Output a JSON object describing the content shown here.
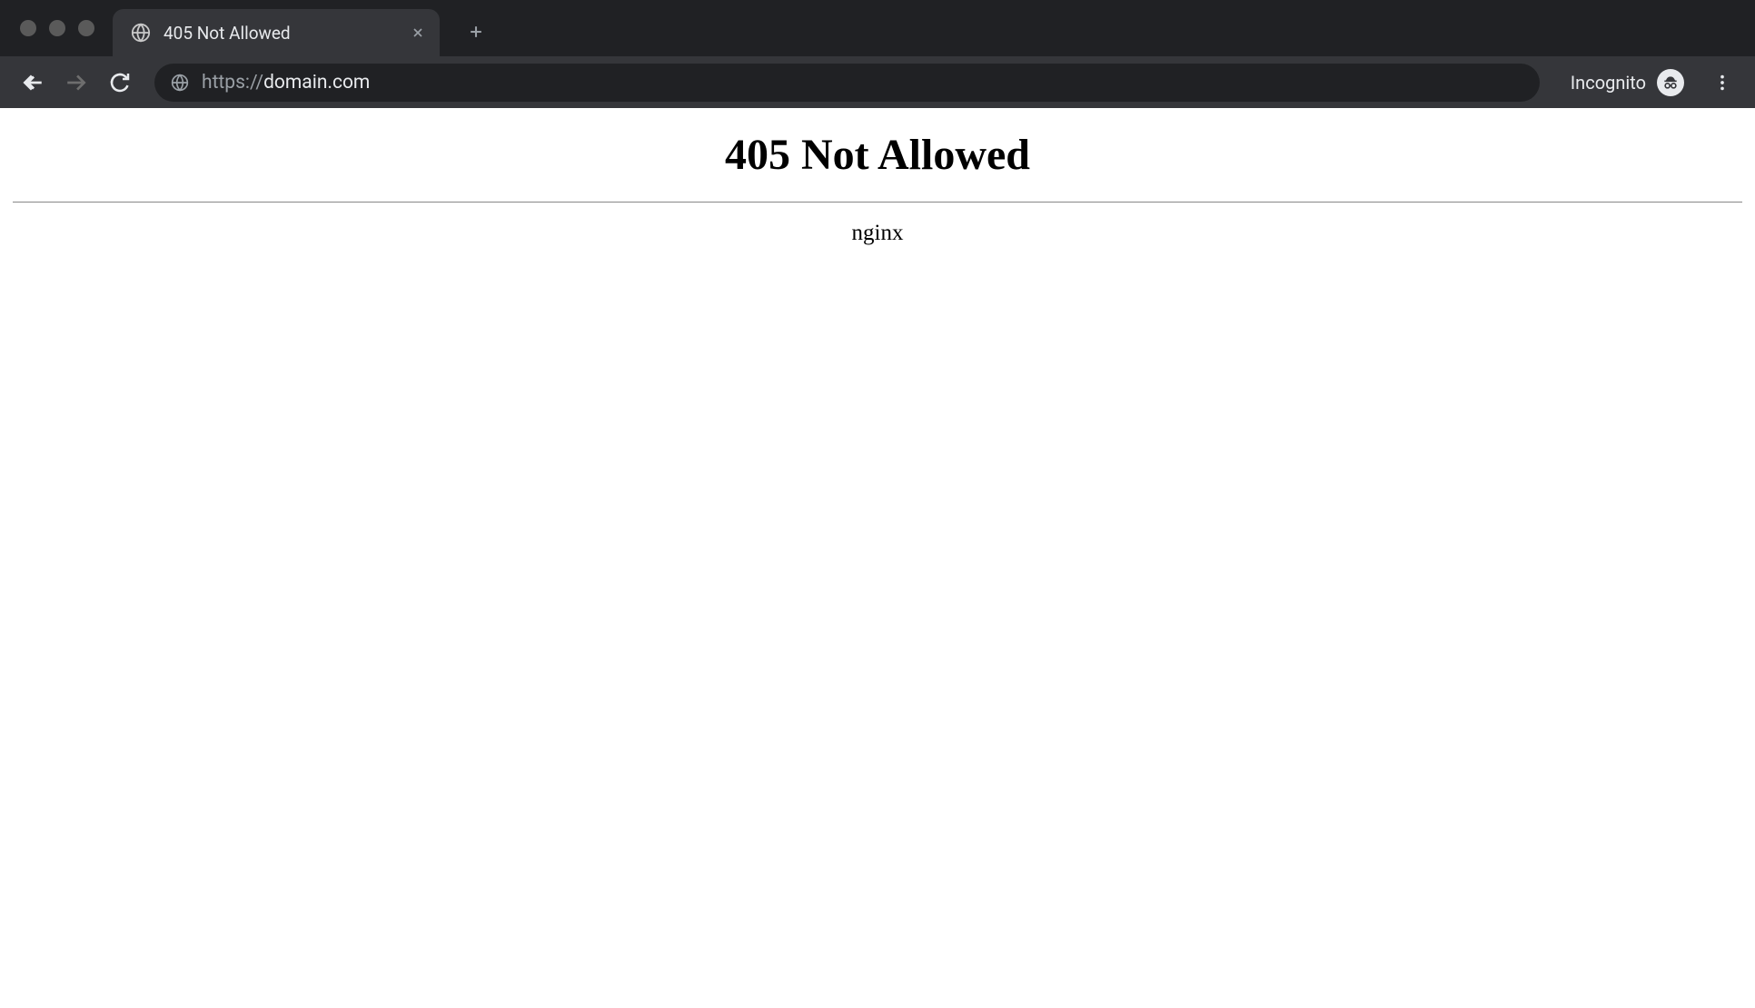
{
  "browser": {
    "tab": {
      "title": "405 Not Allowed"
    },
    "address_bar": {
      "url_scheme": "https://",
      "url_domain": "domain.com"
    },
    "incognito_label": "Incognito"
  },
  "page": {
    "error_heading": "405 Not Allowed",
    "server_name": "nginx"
  }
}
